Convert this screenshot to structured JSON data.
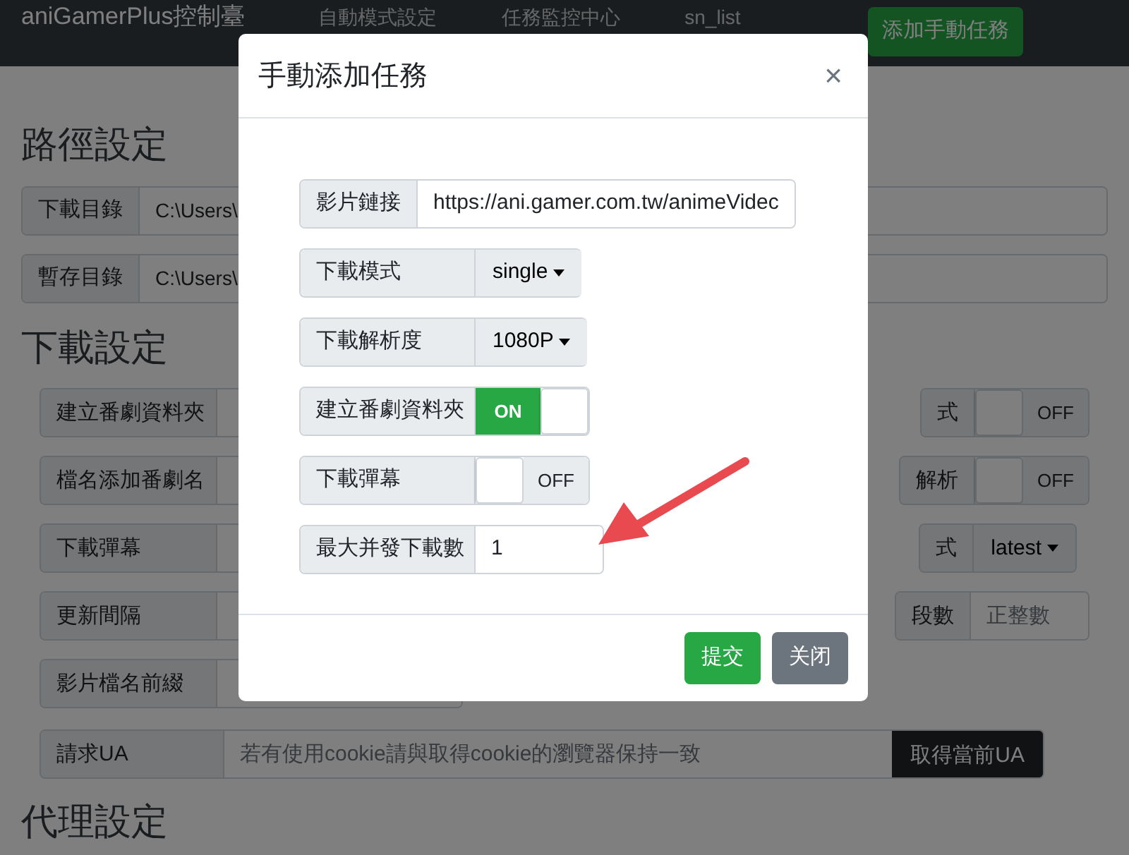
{
  "navbar": {
    "brand": "aniGamerPlus控制臺",
    "links": [
      {
        "label": "自動模式設定"
      },
      {
        "label": "任務監控中心"
      },
      {
        "label": "sn_list"
      }
    ],
    "action_button": "添加手動任務"
  },
  "path_settings": {
    "heading": "路徑設定",
    "rows": [
      {
        "label": "下載目錄",
        "value": "C:\\Users\\"
      },
      {
        "label": "暫存目錄",
        "value": "C:\\Users\\"
      }
    ]
  },
  "download_settings": {
    "heading": "下載設定",
    "rows": [
      {
        "left": {
          "label": "建立番劇資料夾"
        },
        "right": {
          "label": "式",
          "kind": "toggle",
          "on": false,
          "text": "OFF"
        }
      },
      {
        "left": {
          "label": "檔名添加番劇名"
        },
        "right": {
          "label": "解析",
          "kind": "toggle",
          "on": false,
          "text": "OFF"
        }
      },
      {
        "left": {
          "label": "下載彈幕"
        },
        "right": {
          "label": "式",
          "kind": "dropdown",
          "value": "latest"
        }
      },
      {
        "left": {
          "label": "更新間隔"
        },
        "right": {
          "label": "段數",
          "kind": "input",
          "placeholder": "正整數"
        }
      },
      {
        "left": {
          "label": "影片檔名前綴"
        }
      }
    ]
  },
  "ua_row": {
    "label": "請求UA",
    "placeholder": "若有使用cookie請與取得cookie的瀏覽器保持一致",
    "button": "取得當前UA"
  },
  "proxy_settings": {
    "heading": "代理設定"
  },
  "modal": {
    "title": "手動添加任務",
    "close": "×",
    "fields": [
      {
        "label": "影片鏈接",
        "kind": "text",
        "value": "https://ani.gamer.com.tw/animeVidec"
      },
      {
        "label": "下載模式",
        "kind": "dropdown",
        "value": "single"
      },
      {
        "label": "下載解析度",
        "kind": "dropdown",
        "value": "1080P"
      },
      {
        "label": "建立番劇資料夾",
        "kind": "toggle",
        "on": true,
        "text": "ON"
      },
      {
        "label": "下載彈幕",
        "kind": "toggle",
        "on": false,
        "text": "OFF"
      },
      {
        "label": "最大并發下載數",
        "kind": "text",
        "value": "1"
      }
    ],
    "buttons": [
      {
        "label": "提交",
        "kind": "primary"
      },
      {
        "label": "关闭",
        "kind": "secondary"
      }
    ]
  }
}
